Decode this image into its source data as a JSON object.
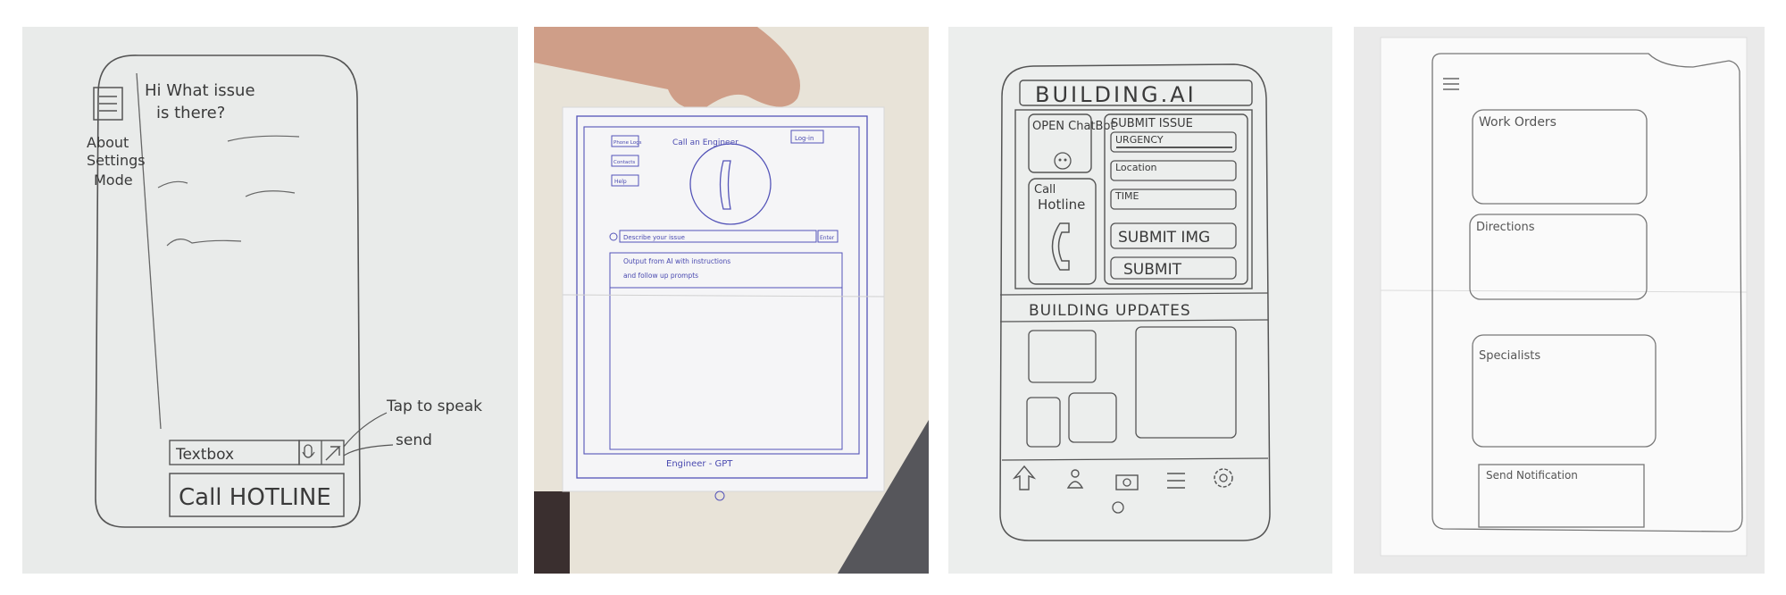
{
  "sketch1": {
    "menu": [
      "About",
      "Settings",
      "Mode"
    ],
    "greeting": [
      "Hi What issue",
      "is there?"
    ],
    "textbox": "Textbox",
    "tap_to_speak": "Tap to speak",
    "send": "send",
    "call_hotline": "Call HOTLINE"
  },
  "sketch2": {
    "side_buttons": [
      "Phone Logs",
      "Contacts",
      "Help"
    ],
    "header": "Call an Engineer",
    "login": "Log-in",
    "describe": "Describe your issue",
    "enter": "Enter",
    "output": [
      "Output from AI with instructions",
      "and follow up prompts"
    ],
    "footer": "Engineer - GPT"
  },
  "sketch3": {
    "title": "BUILDING.AI",
    "open_chatbot": "OPEN ChatBot",
    "submit_issue": "SUBMIT ISSUE",
    "urgency": "URGENCY",
    "location": "Location",
    "time": "TIME",
    "call_hotline": [
      "Call",
      "Hotline"
    ],
    "submit_img": "SUBMIT IMG",
    "submit": "SUBMIT",
    "updates": "BUILDING UPDATES",
    "nav_icons": [
      "home-icon",
      "person-icon",
      "camera-icon",
      "menu-icon",
      "gear-icon"
    ]
  },
  "sketch4": {
    "sections": [
      "Work Orders",
      "Directions",
      "Specialists",
      "Send Notification"
    ]
  }
}
